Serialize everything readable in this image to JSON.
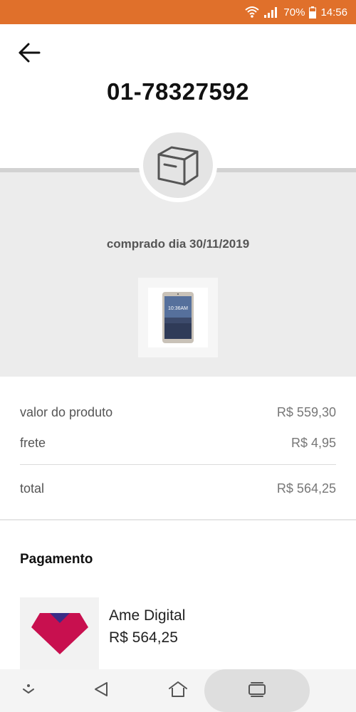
{
  "status_bar": {
    "battery": "70%",
    "time": "14:56",
    "background_color": "#e0702b",
    "icons": [
      "wifi-icon",
      "signal-icon",
      "battery-icon"
    ]
  },
  "header": {
    "back_icon": "arrow-left-icon",
    "order_number": "01-78327592"
  },
  "order": {
    "status_icon": "package-box-icon",
    "purchase_date": "comprado dia 30/11/2019",
    "product_image": "smartphone-product-image"
  },
  "summary": {
    "product_value_label": "valor do produto",
    "product_value": "R$ 559,30",
    "shipping_label": "frete",
    "shipping_value": "R$ 4,95",
    "total_label": "total",
    "total_value": "R$ 564,25"
  },
  "payment": {
    "heading": "Pagamento",
    "method_name": "Ame Digital",
    "amount": "R$ 564,25",
    "logo_colors": [
      "#c8104f",
      "#3b2d86"
    ]
  },
  "navigation": {
    "icons": [
      "notification-down-icon",
      "back-triangle-icon",
      "home-icon",
      "recents-icon"
    ]
  }
}
